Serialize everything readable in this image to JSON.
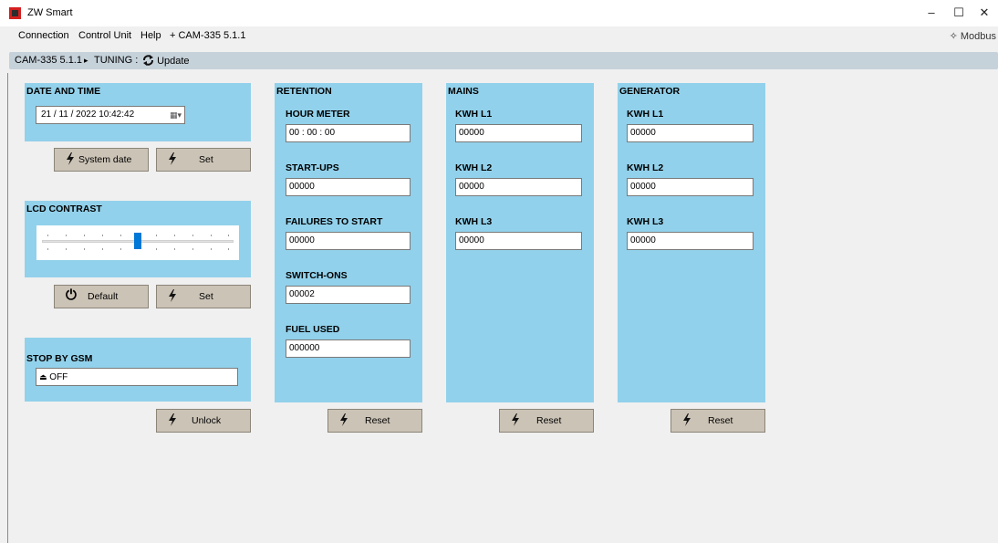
{
  "window": {
    "title": "ZW Smart",
    "minimize": "–",
    "maximize": "☐",
    "close": "✕"
  },
  "menu": {
    "items": [
      "Connection",
      "Control Unit",
      "Help",
      "+ CAM-335 5.1.1"
    ],
    "protocol": "✧ Modbus"
  },
  "breadcrumb": {
    "device": "CAM-335 5.1.1",
    "separator": "▸",
    "section": "TUNING :",
    "update": "Update"
  },
  "date_time": {
    "title": "DATE AND TIME",
    "value": "21 / 11 / 2022  10:42:42",
    "system_date_label": "System date",
    "set_label": "Set"
  },
  "lcd_contrast": {
    "title": "LCD CONTRAST",
    "level_fraction": 0.5,
    "default_label": "Default",
    "set_label": "Set"
  },
  "stop_by_gsm": {
    "title": "STOP BY GSM",
    "value": "OFF",
    "unlock_label": "Unlock"
  },
  "retention": {
    "title": "RETENTION",
    "hour_meter_label": "HOUR METER",
    "hour_meter": "00 : 00 : 00",
    "startups_label": "START-UPS",
    "startups": "00000",
    "failures_label": "FAILURES TO START",
    "failures": "00000",
    "switchons_label": "SWITCH-ONS",
    "switchons": "00002",
    "fuel_label": "FUEL USED",
    "fuel": "000000",
    "reset_label": "Reset"
  },
  "mains": {
    "title": "MAINS",
    "l1_label": "KWH L1",
    "l1": "00000",
    "l2_label": "KWH L2",
    "l2": "00000",
    "l3_label": "KWH L3",
    "l3": "00000",
    "reset_label": "Reset"
  },
  "generator": {
    "title": "GENERATOR",
    "l1_label": "KWH L1",
    "l1": "00000",
    "l2_label": "KWH L2",
    "l2": "00000",
    "l3_label": "KWH L3",
    "l3": "00000",
    "reset_label": "Reset"
  },
  "colors": {
    "panel": "#92d1eb",
    "button": "#cbc3b6",
    "breadcrumb": "#c6d2da",
    "accent": "#0078d7"
  }
}
